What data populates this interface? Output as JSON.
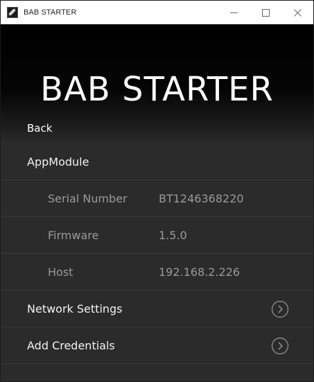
{
  "window": {
    "title": "BAB STARTER",
    "controls": {
      "minimize": "minimize-icon",
      "maximize": "maximize-icon",
      "close": "close-icon"
    }
  },
  "header": {
    "brand": "BAB STARTER",
    "back_label": "Back"
  },
  "list": {
    "section_title": "AppModule",
    "details": [
      {
        "label": "Serial Number",
        "value": "BT1246368220"
      },
      {
        "label": "Firmware",
        "value": "1.5.0"
      },
      {
        "label": "Host",
        "value": "192.168.2.226"
      }
    ],
    "links": [
      {
        "label": "Network Settings",
        "icon": "chevron-right-circle-icon"
      },
      {
        "label": "Add Credentials",
        "icon": "chevron-right-circle-icon"
      }
    ]
  },
  "colors": {
    "background": "#2b2b2b",
    "header_dark": "#000000",
    "text_primary": "#ffffff",
    "text_secondary": "#9a9a9a",
    "divider": "#3a3a3a"
  }
}
